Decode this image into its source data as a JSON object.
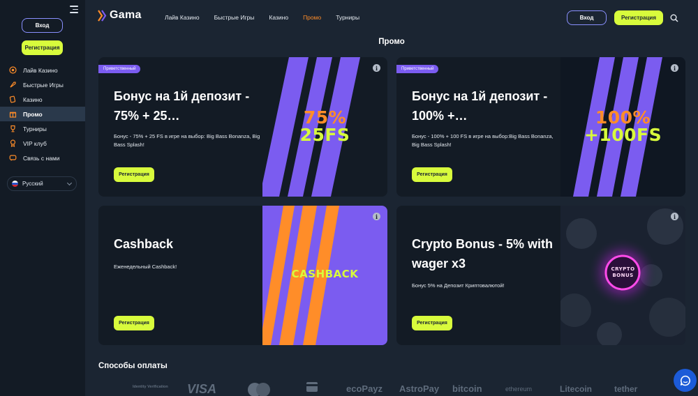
{
  "sidebar": {
    "login_label": "Вход",
    "register_label": "Регистрация",
    "items": [
      {
        "label": "Лайв Казино",
        "icon": "live-casino-icon"
      },
      {
        "label": "Быстрые Игры",
        "icon": "rocket-icon"
      },
      {
        "label": "Казино",
        "icon": "casino-card-icon"
      },
      {
        "label": "Промо",
        "icon": "gift-icon",
        "active": true
      },
      {
        "label": "Турниры",
        "icon": "trophy-icon"
      },
      {
        "label": "VIP клуб",
        "icon": "vip-medal-icon"
      },
      {
        "label": "Связь с нами",
        "icon": "chat-icon"
      }
    ],
    "language": "Русский"
  },
  "header": {
    "logo": "Gama",
    "nav": [
      "Лайв Казино",
      "Быстрые Игры",
      "Казино",
      "Промо",
      "Турниры"
    ],
    "active_nav": "Промо",
    "login_label": "Вход",
    "register_label": "Регистрация"
  },
  "page_title": "Промо",
  "promos": [
    {
      "badge": "Приветственный",
      "title": "Бонус на 1й депозит - 75% + 25…",
      "desc": "Бонус - 75% + 25 FS в игре на выбор: Big Bass Bonanza, Big Bass Splash!",
      "button": "Регистрация",
      "art_line1": "75%",
      "art_line2": "25FS"
    },
    {
      "badge": "Приветственный",
      "title": "Бонус на 1й депозит - 100% +…",
      "desc": "Бонус - 100% + 100 FS в игре на выбор:Big Bass Bonanza, Big Bass Splash!",
      "button": "Регистрация",
      "art_line1": "100%",
      "art_line2": "+100FS"
    },
    {
      "title": "Cashback",
      "desc": "Еженедельный Cashback!",
      "button": "Регистрация",
      "art_line1": "CASHBACK"
    },
    {
      "title": "Crypto Bonus - 5% with wager x3",
      "desc": "Бонус 5% на Депозит Криптовалютой!",
      "button": "Регистрация",
      "art_line1": "CRYPTO",
      "art_line2": "BONUS"
    }
  ],
  "payments": {
    "title": "Способы оплаты",
    "methods": [
      "Identity Verification",
      "VISA",
      "mastercard",
      "bank",
      "ecoPayz",
      "AstroPay",
      "bitcoin",
      "ethereum",
      "Litecoin",
      "tether"
    ]
  },
  "colors": {
    "accent_lime": "#d8fb3c",
    "accent_orange": "#ff8d29",
    "accent_purple": "#7b5cf0",
    "bg": "#1b2532",
    "card_bg": "#131b25"
  }
}
